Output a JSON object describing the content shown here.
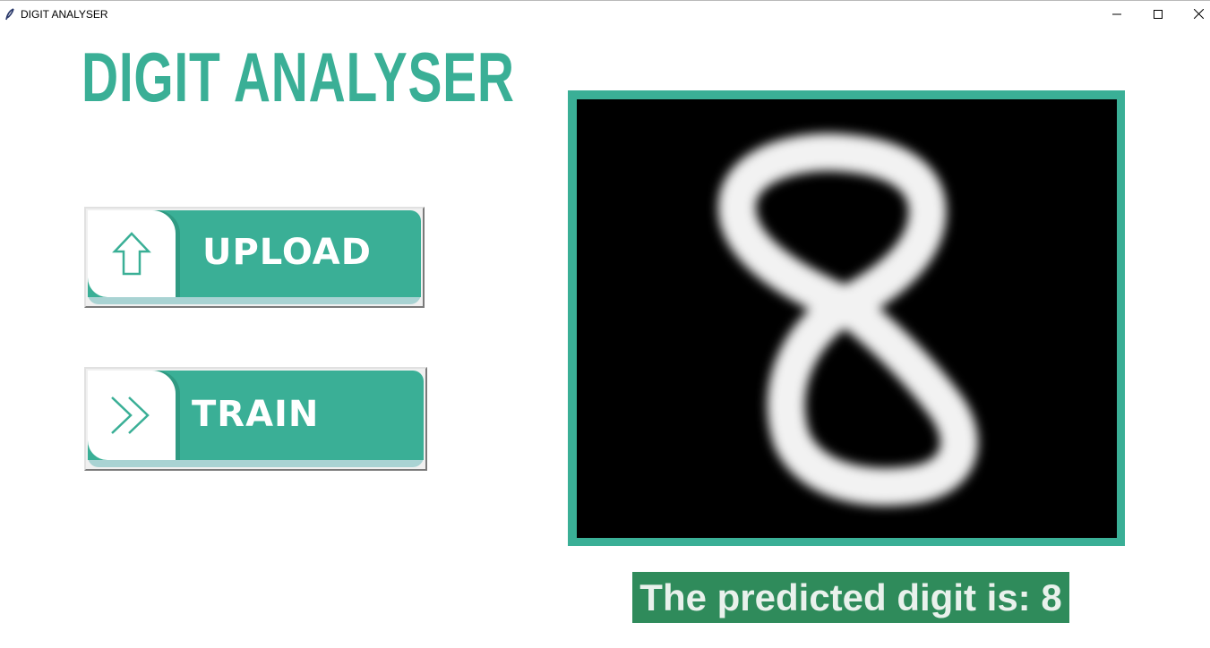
{
  "window": {
    "title": "DIGIT ANALYSER",
    "icon": "feather-icon",
    "controls": [
      "minimize-icon",
      "maximize-icon",
      "close-icon"
    ]
  },
  "app": {
    "title": "DIGIT ANALYSER"
  },
  "buttons": {
    "upload": {
      "label": "UPLOAD",
      "icon": "upload-arrow-icon"
    },
    "train": {
      "label": "TRAIN",
      "icon": "double-chevron-right-icon"
    }
  },
  "image_panel": {
    "content": "handwritten-digit-image"
  },
  "prediction": {
    "text": "The predicted digit is: 8"
  },
  "colors": {
    "accent": "#3aaf96",
    "accent_dark": "#2f9a82",
    "prediction_bg": "#2f8b5b",
    "canvas_bg": "#000000"
  }
}
